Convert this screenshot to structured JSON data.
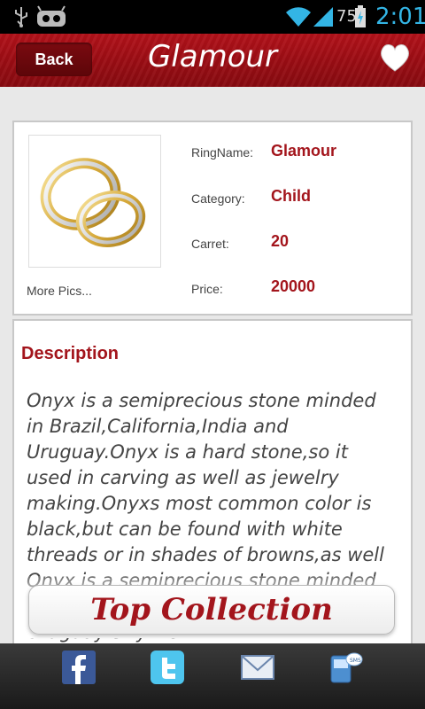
{
  "status_bar": {
    "battery_percent": "75",
    "time": "2:01",
    "icons": [
      "usb-icon",
      "android-icon",
      "wifi-icon",
      "signal-icon",
      "battery-icon"
    ]
  },
  "header": {
    "back_label": "Back",
    "title": "Glamour",
    "favorite_icon": "heart-icon"
  },
  "ring": {
    "more_pics": "More Pics...",
    "fields": [
      {
        "label": "RingName:",
        "value": "Glamour"
      },
      {
        "label": "Category:",
        "value": "Child"
      },
      {
        "label": "Carret:",
        "value": "20"
      },
      {
        "label": "Price:",
        "value": "20000"
      }
    ]
  },
  "description": {
    "title": "Description",
    "text": "Onyx is a semiprecious stone minded in Brazil,California,India and Uruguay.Onyx is a hard stone,so it used in carving as well as jewelry making.Onyxs most common color is black,but can be found with white threads or in shades of browns,as well Onyx is a semiprecious stone minded in Brazil,California,India and Uruguay.Onyx is"
  },
  "top_collection_label": "Top Collection",
  "share_bar": {
    "icons": [
      "facebook-icon",
      "twitter-icon",
      "email-icon",
      "sms-icon"
    ]
  },
  "colors": {
    "accent": "#a3151c",
    "header": "#9c0d14",
    "status_time": "#33b5e5"
  }
}
